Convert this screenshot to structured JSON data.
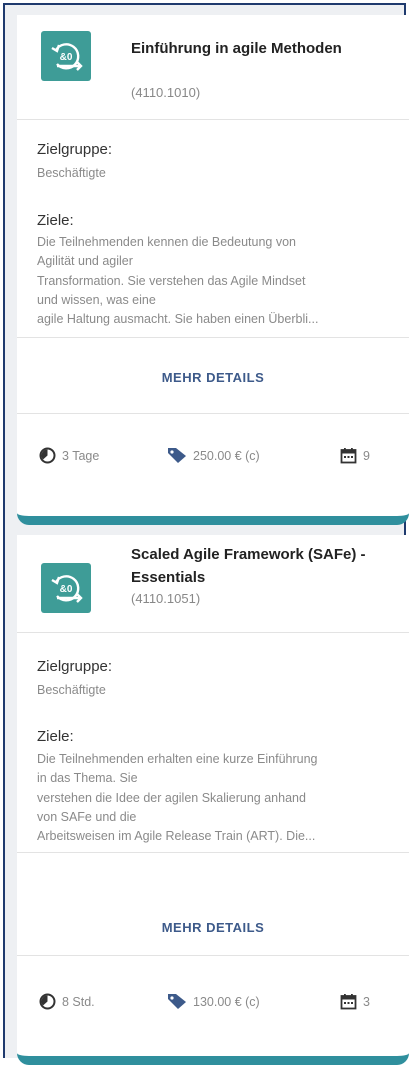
{
  "cards": [
    {
      "title": "Einführung in agile Methoden",
      "code": "(4110.1010)",
      "zielgruppe_label": "Zielgruppe:",
      "zielgruppe_value": "Beschäftigte",
      "ziele_label": "Ziele:",
      "ziele_text": "Die Teilnehmenden kennen die Bedeutung von\nAgilität und agiler\nTransformation. Sie verstehen das Agile Mindset\nund wissen, was eine\nagile Haltung ausmacht. Sie haben einen Überbli...",
      "details_label": "MEHR DETAILS",
      "duration": "3 Tage",
      "price": "250.00 € (c)",
      "dates": "9"
    },
    {
      "title": "Scaled Agile Framework (SAFe) - Essentials",
      "code": "(4110.1051)",
      "zielgruppe_label": "Zielgruppe:",
      "zielgruppe_value": "Beschäftigte",
      "ziele_label": "Ziele:",
      "ziele_text": "Die Teilnehmenden erhalten eine kurze Einführung\nin das Thema. Sie\nverstehen die Idee der agilen Skalierung anhand\nvon SAFe und die\nArbeitsweisen im Agile Release Train (ART). Die...",
      "details_label": "MEHR DETAILS",
      "duration": "8 Std.",
      "price": "130.00 € (c)",
      "dates": "3"
    }
  ],
  "colors": {
    "logo": "#3e9c97",
    "accent": "#2f8f9d",
    "link": "#3d5a8a",
    "frame": "#1f3a6e"
  }
}
